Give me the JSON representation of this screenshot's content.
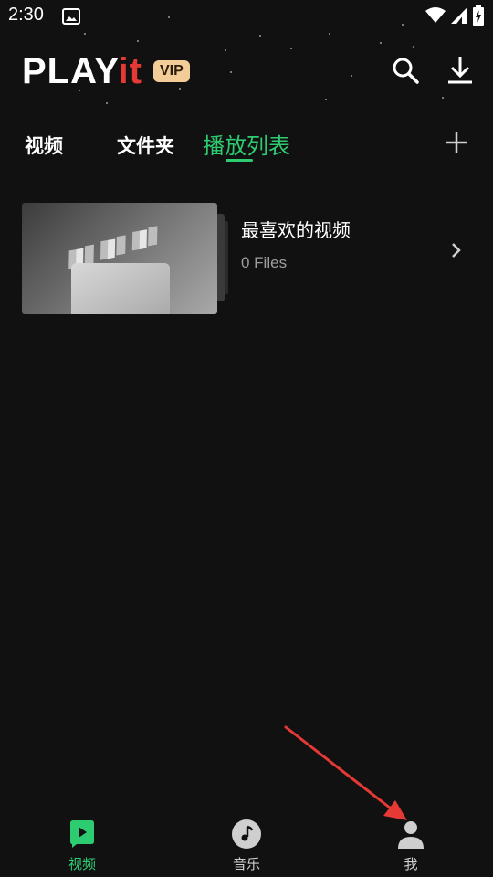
{
  "status_bar": {
    "time": "2:30",
    "icons": [
      "image-icon",
      "wifi-icon",
      "signal-icon",
      "battery-charging-icon"
    ]
  },
  "header": {
    "logo_main": "PLAY",
    "logo_accent": "it",
    "vip_badge": "VIP",
    "icons": [
      "search-icon",
      "download-icon"
    ]
  },
  "tabs": [
    {
      "label": "视频",
      "active": false
    },
    {
      "label": "文件夹",
      "active": false
    },
    {
      "label": "播放列表",
      "active": true
    }
  ],
  "add_icon": "plus-icon",
  "playlist": {
    "title": "最喜欢的视频",
    "count": "0 Files"
  },
  "bottom_nav": [
    {
      "label": "视频",
      "icon": "video-play-icon",
      "active": true
    },
    {
      "label": "音乐",
      "icon": "music-note-icon",
      "active": false
    },
    {
      "label": "我",
      "icon": "profile-icon",
      "active": false
    }
  ],
  "colors": {
    "accent": "#2ecc71",
    "background": "#111111",
    "vip_badge": "#f2cd98",
    "annotation_arrow": "#e53935"
  }
}
